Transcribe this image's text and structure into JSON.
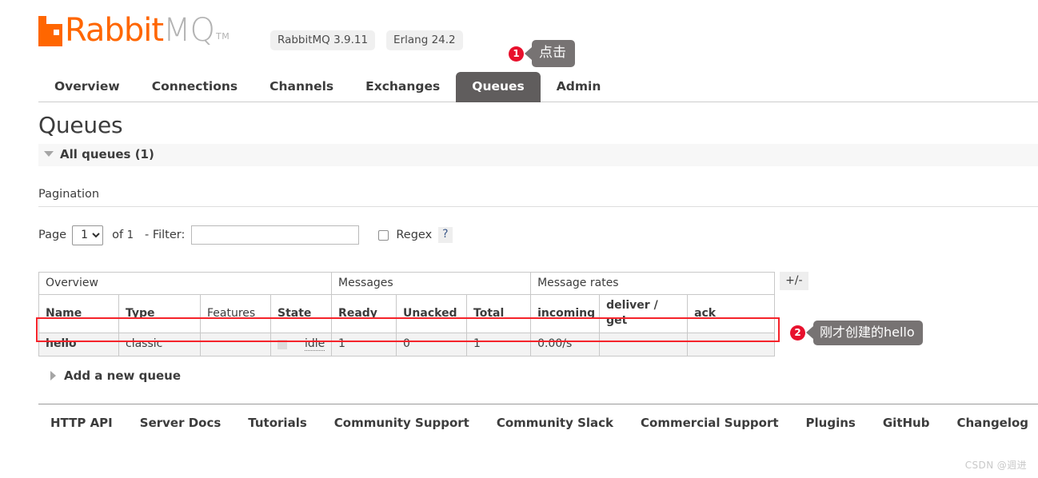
{
  "header": {
    "logo": {
      "mark_icon": "rabbitmq-logo-icon",
      "text_primary": "Rabbit",
      "text_secondary": "MQ",
      "trademark": "TM",
      "color": "#ff6600"
    },
    "badges": [
      {
        "label": "RabbitMQ 3.9.11"
      },
      {
        "label": "Erlang 24.2"
      }
    ]
  },
  "nav": {
    "items": [
      {
        "label": "Overview",
        "active": false
      },
      {
        "label": "Connections",
        "active": false
      },
      {
        "label": "Channels",
        "active": false
      },
      {
        "label": "Exchanges",
        "active": false
      },
      {
        "label": "Queues",
        "active": true
      },
      {
        "label": "Admin",
        "active": false
      }
    ],
    "active_color": "#605d5d"
  },
  "annotations": [
    {
      "number": "1",
      "text": "点击",
      "color": "#e8112d",
      "bubble_color": "#777373"
    },
    {
      "number": "2",
      "text": "刚才创建的hello",
      "color": "#e8112d",
      "bubble_color": "#777373"
    }
  ],
  "main": {
    "page_title": "Queues",
    "all_queues_label": "All queues (1)",
    "pagination_heading": "Pagination",
    "pagination": {
      "page_label": "Page",
      "page_value": "1",
      "page_options": [
        "1"
      ],
      "of_label": "of",
      "of_value": "1",
      "filter_label": "- Filter:",
      "filter_value": "",
      "filter_placeholder": "",
      "regex_label": "Regex",
      "regex_checked": false,
      "help_label": "?"
    },
    "table": {
      "group_headers": [
        {
          "label": "Overview",
          "span": 4
        },
        {
          "label": "Messages",
          "span": 3
        },
        {
          "label": "Message rates",
          "span": 3
        }
      ],
      "columns": [
        {
          "label": "Name",
          "bold": true,
          "align": "left"
        },
        {
          "label": "Type",
          "bold": true,
          "align": "left"
        },
        {
          "label": "Features",
          "bold": false,
          "align": "left"
        },
        {
          "label": "State",
          "bold": true,
          "align": "left"
        },
        {
          "label": "Ready",
          "bold": true,
          "align": "right"
        },
        {
          "label": "Unacked",
          "bold": true,
          "align": "right"
        },
        {
          "label": "Total",
          "bold": true,
          "align": "right"
        },
        {
          "label": "incoming",
          "bold": true,
          "align": "right"
        },
        {
          "label": "deliver / get",
          "bold": true,
          "align": "left"
        },
        {
          "label": "ack",
          "bold": true,
          "align": "left"
        }
      ],
      "rows": [
        {
          "name": "hello",
          "type": "classic",
          "features": "",
          "state": "idle",
          "ready": "1",
          "unacked": "0",
          "total": "1",
          "incoming": "0.00/s",
          "deliver_get": "",
          "ack": "",
          "highlighted": true,
          "highlight_color": "#f5232a"
        }
      ],
      "toggle_columns_label": "+/-"
    },
    "add_queue_label": "Add a new queue"
  },
  "footer": {
    "links": [
      {
        "label": "HTTP API"
      },
      {
        "label": "Server Docs"
      },
      {
        "label": "Tutorials"
      },
      {
        "label": "Community Support"
      },
      {
        "label": "Community Slack"
      },
      {
        "label": "Commercial Support"
      },
      {
        "label": "Plugins"
      },
      {
        "label": "GitHub"
      },
      {
        "label": "Changelog"
      }
    ]
  },
  "watermark": "CSDN @週进"
}
